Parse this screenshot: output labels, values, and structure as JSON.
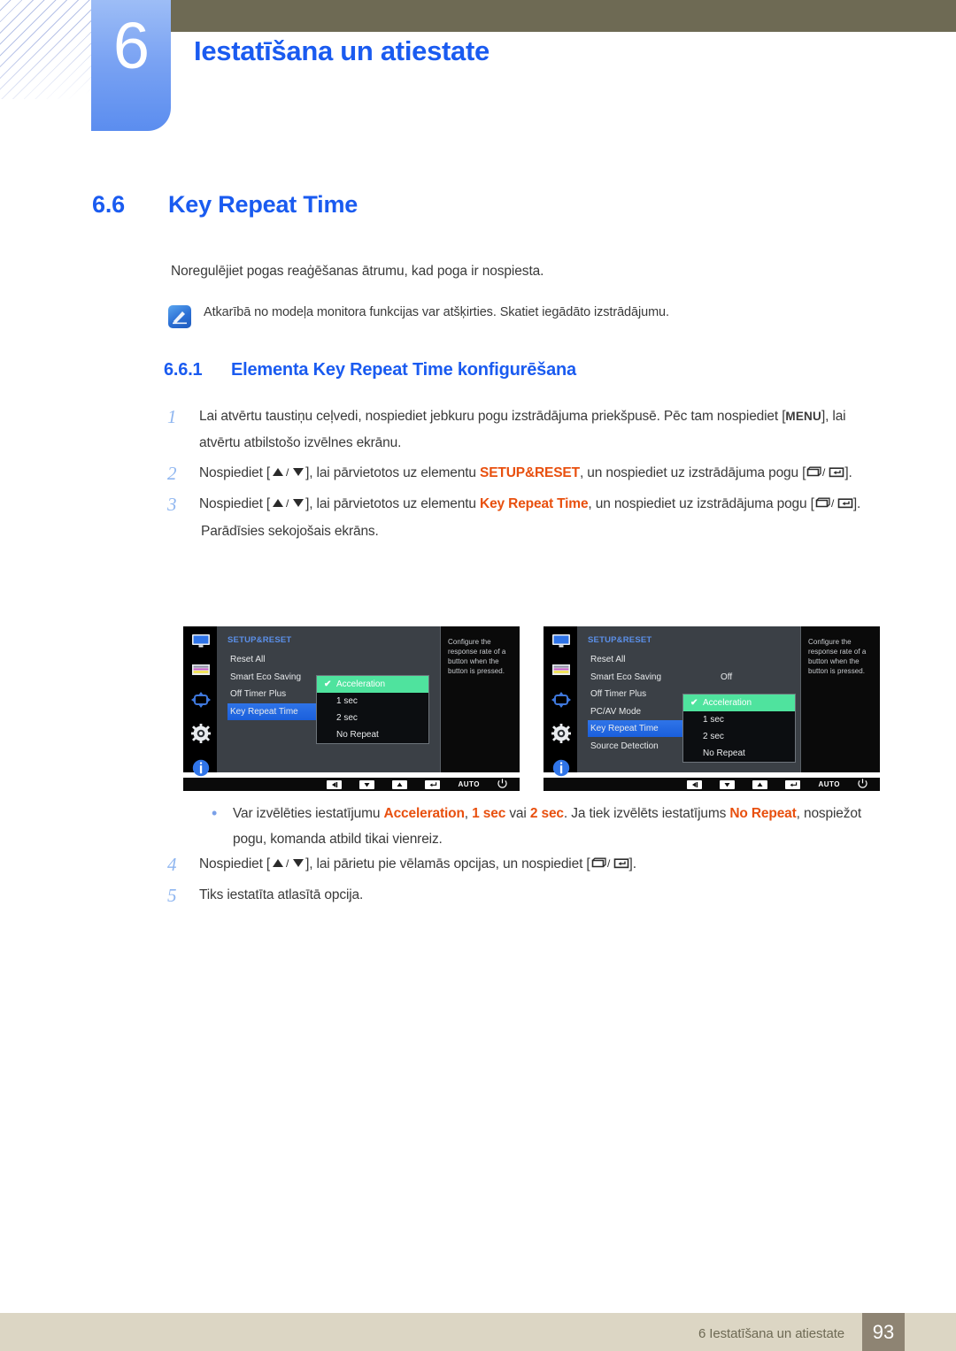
{
  "header": {
    "chapter_number": "6",
    "chapter_title": "Iestatīšana un atiestate",
    "accent_color": "#1a5bf0",
    "bar_color": "#6e6a54"
  },
  "section": {
    "number": "6.6",
    "title": "Key Repeat Time",
    "intro": "Noregulējiet pogas reaģēšanas ātrumu, kad poga ir nospiesta.",
    "note_icon": "note-pen-icon",
    "note_text": "Atkarībā no modeļa monitora funkcijas var atšķirties. Skatiet iegādāto izstrādājumu."
  },
  "subsection": {
    "number": "6.6.1",
    "title": "Elementa Key Repeat Time konfigurēšana"
  },
  "steps": [
    {
      "n": "1",
      "parts": [
        {
          "t": "Lai atvērtu taustiņu ceļvedi, nospiediet jebkuru pogu izstrādājuma priekšpusē. Pēc tam nospiediet [",
          "k": "plain"
        },
        {
          "t": "MENU",
          "k": "kbd"
        },
        {
          "t": "], lai atvērtu atbilstošo izvēlnes ekrānu.",
          "k": "plain"
        }
      ]
    },
    {
      "n": "2",
      "parts": [
        {
          "t": "Nospiediet [",
          "k": "plain"
        },
        {
          "t": "updown",
          "k": "glyph"
        },
        {
          "t": "], lai pārvietotos uz elementu ",
          "k": "plain"
        },
        {
          "t": "SETUP&RESET",
          "k": "orange"
        },
        {
          "t": ", un nospiediet uz izstrādājuma pogu [",
          "k": "plain"
        },
        {
          "t": "enterpair",
          "k": "glyph"
        },
        {
          "t": "].",
          "k": "plain"
        }
      ]
    },
    {
      "n": "3",
      "parts": [
        {
          "t": "Nospiediet [",
          "k": "plain"
        },
        {
          "t": "updown",
          "k": "glyph"
        },
        {
          "t": "], lai pārvietotos uz elementu ",
          "k": "plain"
        },
        {
          "t": "Key Repeat Time",
          "k": "orange"
        },
        {
          "t": ", un nospiediet uz izstrādājuma pogu [",
          "k": "plain"
        },
        {
          "t": "enterpair",
          "k": "glyph"
        },
        {
          "t": "].",
          "k": "plain"
        }
      ],
      "sub": "Parādīsies sekojošais ekrāns."
    }
  ],
  "bullet": {
    "marker": "•",
    "parts": [
      {
        "t": "Var izvēlēties iestatījumu ",
        "k": "plain"
      },
      {
        "t": "Acceleration",
        "k": "orange"
      },
      {
        "t": ", ",
        "k": "plain"
      },
      {
        "t": "1 sec",
        "k": "orange"
      },
      {
        "t": " vai ",
        "k": "plain"
      },
      {
        "t": "2 sec",
        "k": "orange"
      },
      {
        "t": ". Ja tiek izvēlēts iestatījums ",
        "k": "plain"
      },
      {
        "t": "No Repeat",
        "k": "orange"
      },
      {
        "t": ", nospiežot pogu, komanda atbild tikai vienreiz.",
        "k": "plain"
      }
    ]
  },
  "steps2": [
    {
      "n": "4",
      "parts": [
        {
          "t": "Nospiediet [",
          "k": "plain"
        },
        {
          "t": "updown",
          "k": "glyph"
        },
        {
          "t": "], lai pārietu pie vēlamās opcijas, un nospiediet [",
          "k": "plain"
        },
        {
          "t": "enterpair",
          "k": "glyph"
        },
        {
          "t": "].",
          "k": "plain"
        }
      ]
    },
    {
      "n": "5",
      "parts": [
        {
          "t": "Tiks iestatīta atlasītā opcija.",
          "k": "plain"
        }
      ]
    }
  ],
  "osd_left": {
    "title": "SETUP&RESET",
    "sidebar_icons": [
      "monitor-icon",
      "picture-icon",
      "move-arrows-icon",
      "gear-icon",
      "info-icon"
    ],
    "selected_sidebar_index": 3,
    "menu": [
      {
        "label": "Reset All",
        "value": "",
        "selected": false
      },
      {
        "label": "Smart Eco Saving",
        "value": "",
        "selected": false
      },
      {
        "label": "Off Timer Plus",
        "value": "",
        "selected": false
      },
      {
        "label": "Key Repeat Time",
        "value": "",
        "selected": true
      }
    ],
    "submenu": [
      {
        "label": "Acceleration",
        "checked": true
      },
      {
        "label": "1 sec",
        "checked": false
      },
      {
        "label": "2 sec",
        "checked": false
      },
      {
        "label": "No Repeat",
        "checked": false
      }
    ],
    "description": "Configure the response rate of a button when the button is pressed.",
    "buttons": [
      "left-arrow-button",
      "down-arrow-button",
      "up-arrow-button",
      "enter-button",
      "AUTO",
      "power-button"
    ],
    "auto_label": "AUTO",
    "highlight_color": "#4fe39e",
    "selected_color": "#1a5fdc"
  },
  "osd_right": {
    "title": "SETUP&RESET",
    "sidebar_icons": [
      "monitor-icon",
      "picture-icon",
      "move-arrows-icon",
      "gear-icon",
      "info-icon"
    ],
    "selected_sidebar_index": 3,
    "menu": [
      {
        "label": "Reset All",
        "value": "",
        "selected": false
      },
      {
        "label": "Smart Eco Saving",
        "value": "Off",
        "selected": false
      },
      {
        "label": "Off Timer Plus",
        "value": "",
        "selected": false
      },
      {
        "label": "PC/AV Mode",
        "value": "",
        "selected": false
      },
      {
        "label": "Key Repeat Time",
        "value": "",
        "selected": true
      },
      {
        "label": "Source Detection",
        "value": "",
        "selected": false
      }
    ],
    "submenu": [
      {
        "label": "Acceleration",
        "checked": true
      },
      {
        "label": "1 sec",
        "checked": false
      },
      {
        "label": "2 sec",
        "checked": false
      },
      {
        "label": "No Repeat",
        "checked": false
      }
    ],
    "description": "Configure the response rate of a button when the button is pressed.",
    "buttons": [
      "left-arrow-button",
      "down-arrow-button",
      "up-arrow-button",
      "enter-button",
      "AUTO",
      "power-button"
    ],
    "auto_label": "AUTO"
  },
  "footer": {
    "text": "6 Iestatīšana un atiestate",
    "page": "93"
  }
}
